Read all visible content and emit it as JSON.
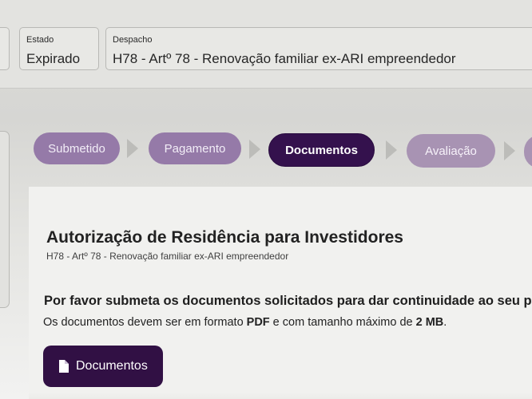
{
  "header": {
    "estado_label": "Estado",
    "estado_value": "Expirado",
    "despacho_label": "Despacho",
    "despacho_value": "H78 - Artº 78 - Renovação familiar ex-ARI empreendedor"
  },
  "progress": {
    "steps": [
      {
        "label": "Submetido",
        "status": "completed"
      },
      {
        "label": "Pagamento",
        "status": "completed"
      },
      {
        "label": "Documentos",
        "status": "current"
      },
      {
        "label": "Avaliação",
        "status": "pending"
      }
    ]
  },
  "main": {
    "title": "Autorização de Residência para Investidores",
    "subtitle": "H78 - Artº 78 - Renovação familiar ex-ARI empreendedor",
    "instruction": "Por favor submeta os documentos solicitados para dar continuidade ao seu pe",
    "requirements": {
      "prefix": "Os documentos devem ser em formato ",
      "format": "PDF",
      "middle": " e com tamanho máximo de ",
      "size": "2 MB",
      "suffix": "."
    },
    "documents_button": "Documentos"
  },
  "colors": {
    "primary": "#311044",
    "completed_step": "#957aa8",
    "pending_step": "#a893b3"
  },
  "icons": {
    "documents_button_icon": "document-icon",
    "step_separator_icon": "chevron-right-icon"
  }
}
